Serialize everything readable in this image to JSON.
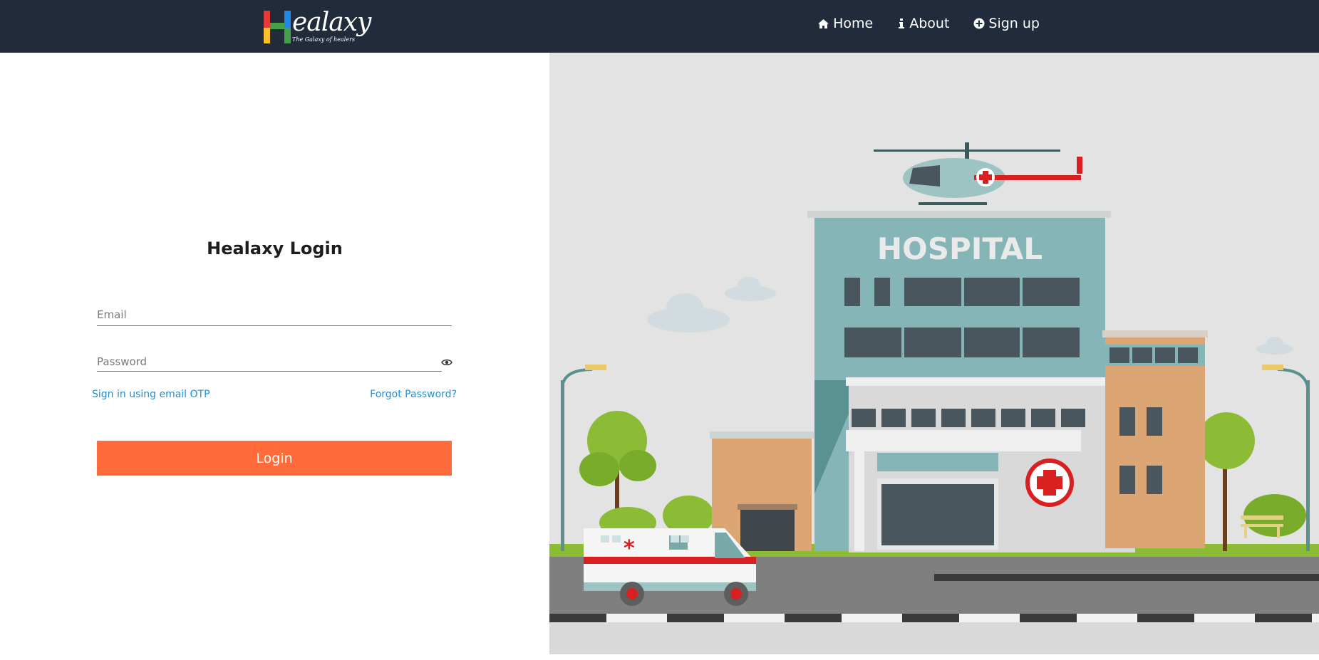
{
  "brand": {
    "name": "ealaxy",
    "tagline": "The Galaxy of healers"
  },
  "nav": {
    "home": "Home",
    "about": "About",
    "signup": "Sign up"
  },
  "login": {
    "title": "Healaxy Login",
    "email_placeholder": "Email",
    "password_placeholder": "Password",
    "otp_link": "Sign in using email OTP",
    "forgot_link": "Forgot Password?",
    "login_button": "Login"
  },
  "hero": {
    "building_sign": "HOSPITAL"
  },
  "colors": {
    "navbar": "#222b3c",
    "accent": "#ff6b3b",
    "link": "#1f8fd8"
  }
}
